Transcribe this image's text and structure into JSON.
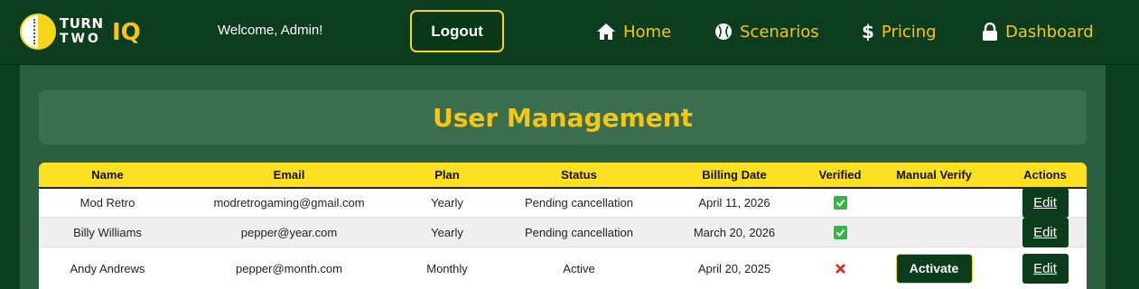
{
  "brand": {
    "line1": "TURN",
    "line2": "TWO",
    "suffix": "IQ",
    "accent_color": "#f7c515",
    "icon": "baseball-icon"
  },
  "header": {
    "welcome": "Welcome, Admin!",
    "logout_label": "Logout",
    "nav": [
      {
        "label": "Home",
        "icon": "home-icon"
      },
      {
        "label": "Scenarios",
        "icon": "baseball-icon"
      },
      {
        "label": "Pricing",
        "icon": "dollar-icon"
      },
      {
        "label": "Dashboard",
        "icon": "lock-icon"
      }
    ]
  },
  "main": {
    "title": "User Management"
  },
  "table": {
    "columns": [
      "Name",
      "Email",
      "Plan",
      "Status",
      "Billing Date",
      "Verified",
      "Manual Verify",
      "Actions"
    ],
    "rows": [
      {
        "name": "Mod Retro",
        "email": "modretrogaming@gmail.com",
        "plan": "Yearly",
        "status": "Pending cancellation",
        "billing_date": "April 11, 2026",
        "verified": true,
        "manual_verify": "",
        "action": "Edit"
      },
      {
        "name": "Billy Williams",
        "email": "pepper@year.com",
        "plan": "Yearly",
        "status": "Pending cancellation",
        "billing_date": "March 20, 2026",
        "verified": true,
        "manual_verify": "",
        "action": "Edit"
      },
      {
        "name": "Andy Andrews",
        "email": "pepper@month.com",
        "plan": "Monthly",
        "status": "Active",
        "billing_date": "April 20, 2025",
        "verified": false,
        "manual_verify": "Activate",
        "action": "Edit"
      }
    ]
  },
  "colors": {
    "nav_bg": "#0c3d1e",
    "content_bg": "#2b5f3f",
    "header_row": "#fde021",
    "button_bg": "#0b3d1d"
  }
}
